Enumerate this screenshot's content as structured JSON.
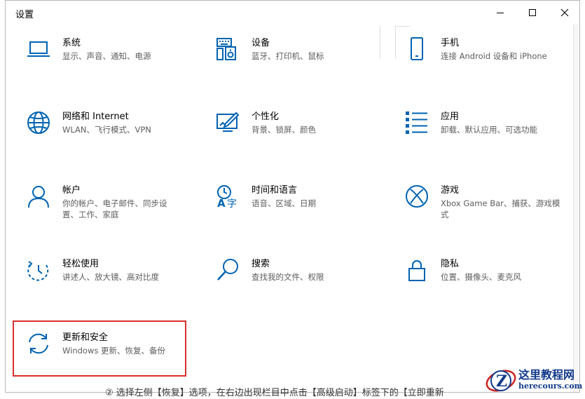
{
  "window": {
    "title": "设置",
    "controls": {
      "minimize": "minimize-icon",
      "maximize": "maximize-icon",
      "close": "close-icon"
    }
  },
  "tiles": [
    {
      "title": "系统",
      "desc": "显示、声音、通知、电源",
      "icon": "laptop-icon"
    },
    {
      "title": "设备",
      "desc": "蓝牙、打印机、鼠标",
      "icon": "keyboard-speaker-icon"
    },
    {
      "title": "手机",
      "desc": "连接 Android 设备和 iPhone",
      "icon": "phone-icon"
    },
    {
      "title": "网络和 Internet",
      "desc": "WLAN、飞行模式、VPN",
      "icon": "globe-icon"
    },
    {
      "title": "个性化",
      "desc": "背景、锁屏、颜色",
      "icon": "paint-icon"
    },
    {
      "title": "应用",
      "desc": "卸载、默认应用、可选功能",
      "icon": "apps-list-icon"
    },
    {
      "title": "帐户",
      "desc": "你的帐户、电子邮件、同步设置、工作、家庭",
      "icon": "person-icon"
    },
    {
      "title": "时间和语言",
      "desc": "语音、区域、日期",
      "icon": "time-language-icon"
    },
    {
      "title": "游戏",
      "desc": "Xbox Game Bar、捕获、游戏模式",
      "icon": "xbox-icon"
    },
    {
      "title": "轻松使用",
      "desc": "讲述人、放大镜、高对比度",
      "icon": "ease-of-access-icon"
    },
    {
      "title": "搜索",
      "desc": "查找我的文件、权限",
      "icon": "search-icon"
    },
    {
      "title": "隐私",
      "desc": "位置、摄像头、麦克风",
      "icon": "lock-icon"
    },
    {
      "title": "更新和安全",
      "desc": "Windows 更新、恢复、备份",
      "icon": "sync-icon"
    }
  ],
  "caption": "② 选择左侧【恢复】选项，在右边出现栏目中点击【高级启动】标签下的【立即重新",
  "watermark": {
    "name": "这里教程网",
    "url": "herecours.com"
  },
  "colors": {
    "accent": "#0063b1",
    "highlight": "#d9302b",
    "watermark": "#123a8a"
  }
}
